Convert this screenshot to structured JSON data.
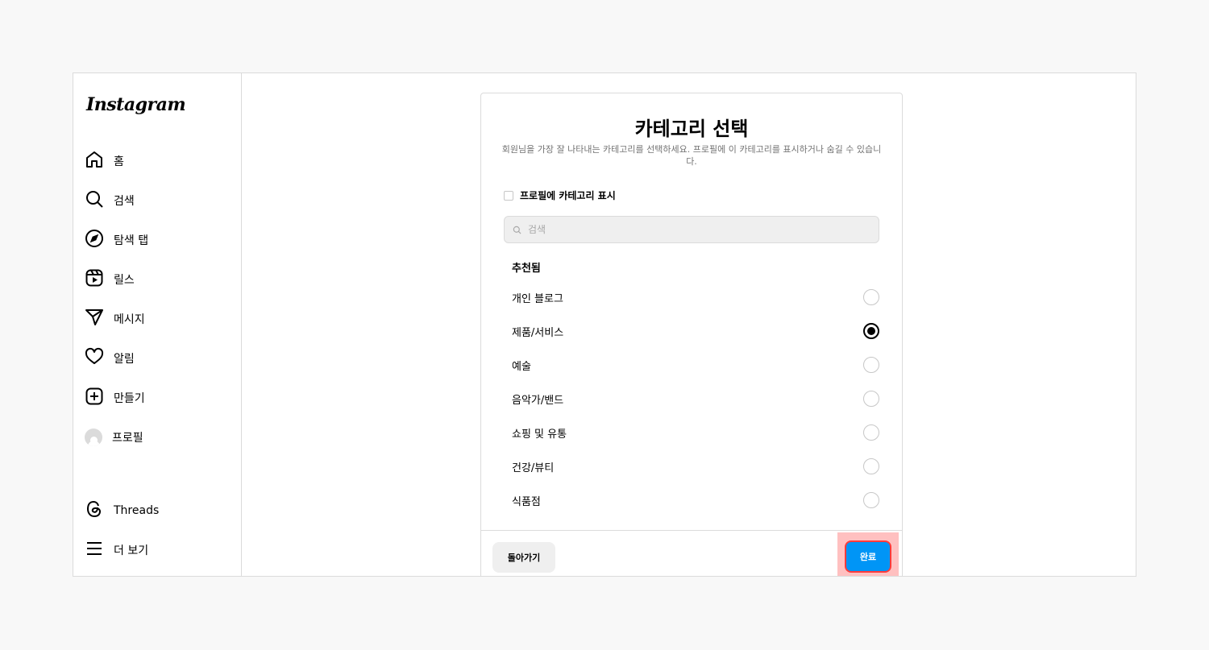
{
  "app": {
    "logo": "Instagram"
  },
  "sidebar": {
    "items": [
      {
        "label": "홈",
        "icon": "home-icon"
      },
      {
        "label": "검색",
        "icon": "search-icon"
      },
      {
        "label": "탐색 탭",
        "icon": "compass-icon"
      },
      {
        "label": "릴스",
        "icon": "reels-icon"
      },
      {
        "label": "메시지",
        "icon": "send-icon"
      },
      {
        "label": "알림",
        "icon": "heart-icon"
      },
      {
        "label": "만들기",
        "icon": "plus-square-icon"
      },
      {
        "label": "프로필",
        "icon": "avatar"
      }
    ],
    "bottom": [
      {
        "label": "Threads",
        "icon": "threads-icon"
      },
      {
        "label": "더 보기",
        "icon": "menu-icon"
      }
    ]
  },
  "dialog": {
    "title": "카테고리 선택",
    "subtitle": "회원님을 가장 잘 나타내는 카테고리를 선택하세요. 프로필에 이 카테고리를 표시하거나 숨길 수 있습니다.",
    "show_category_label": "프로필에 카테고리 표시",
    "show_category_checked": false,
    "search_placeholder": "검색",
    "section_title": "추천됨",
    "categories": [
      {
        "label": "개인 블로그",
        "selected": false
      },
      {
        "label": "제품/서비스",
        "selected": true
      },
      {
        "label": "예술",
        "selected": false
      },
      {
        "label": "음악가/밴드",
        "selected": false
      },
      {
        "label": "쇼핑 및 유통",
        "selected": false
      },
      {
        "label": "건강/뷰티",
        "selected": false
      },
      {
        "label": "식품점",
        "selected": false
      }
    ],
    "back_label": "돌아가기",
    "done_label": "완료"
  },
  "colors": {
    "primary": "#0095f6",
    "highlight": "#ff3b3b"
  }
}
